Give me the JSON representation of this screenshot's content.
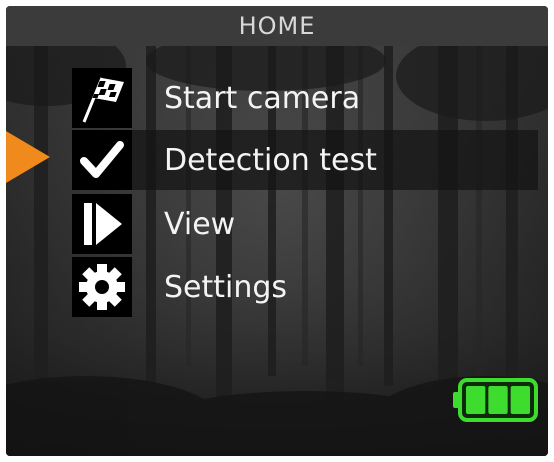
{
  "header": {
    "title": "HOME"
  },
  "menu": {
    "selected_index": 1,
    "items": [
      {
        "label": "Start camera",
        "icon": "checkered-flag-icon"
      },
      {
        "label": "Detection test",
        "icon": "checkmark-icon"
      },
      {
        "label": "View",
        "icon": "play-icon"
      },
      {
        "label": "Settings",
        "icon": "gear-icon"
      }
    ]
  },
  "battery": {
    "level_bars": 3,
    "max_bars": 3,
    "color": "#3ddc2f"
  },
  "colors": {
    "pointer": "#f08a1c",
    "header_bg": "#3b3b3b"
  }
}
